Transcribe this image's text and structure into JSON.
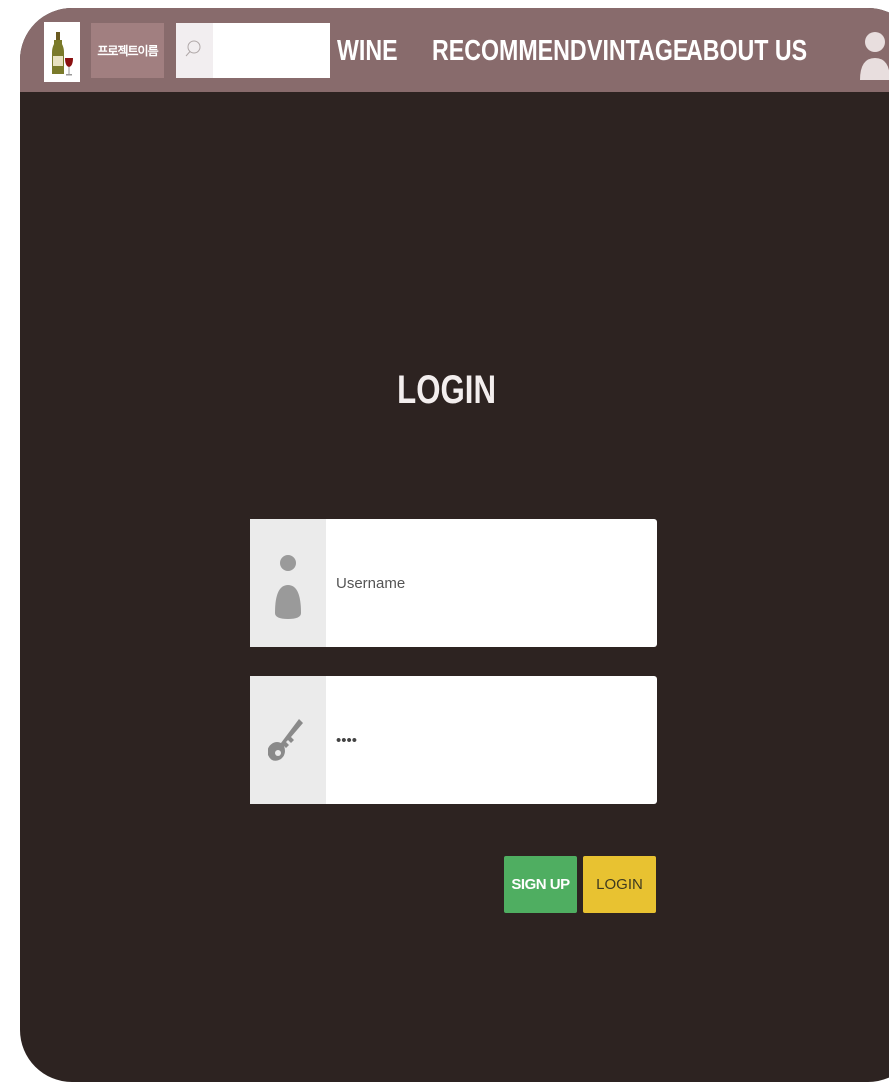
{
  "header": {
    "project_name": "프로젝트이름",
    "search": {
      "value": "",
      "placeholder": ""
    },
    "nav": {
      "wine": "WINE",
      "recommend": "RECOMMEND",
      "vintage": "VINTAGE",
      "about": "ABOUT US"
    },
    "icons": {
      "logo": "wine-bottle-glass-icon",
      "search": "search-icon",
      "user": "user-icon"
    }
  },
  "login": {
    "title": "LOGIN",
    "username": {
      "placeholder": "Username",
      "value": "",
      "icon": "user-icon"
    },
    "password": {
      "value": "••••",
      "icon": "key-icon"
    },
    "buttons": {
      "signup": "SIGN UP",
      "login": "LOGIN"
    }
  },
  "colors": {
    "topbar": "#886b6c",
    "background": "#2d2321",
    "signup": "#4fae61",
    "login": "#e8c231"
  }
}
